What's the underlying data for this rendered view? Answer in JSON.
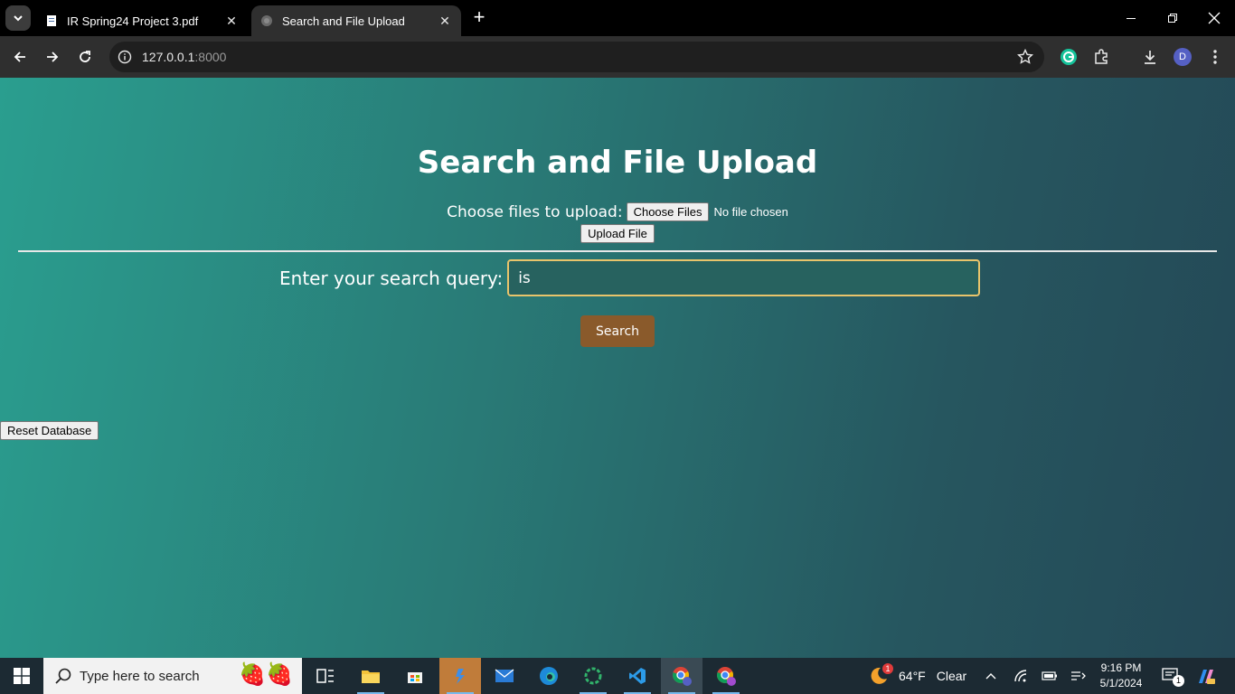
{
  "browser": {
    "tabs": [
      {
        "title": "IR Spring24 Project 3.pdf",
        "active": false
      },
      {
        "title": "Search and File Upload",
        "active": true
      }
    ],
    "url_host": "127.0.0.1",
    "url_port": ":8000",
    "profile_initial": "D"
  },
  "page": {
    "title": "Search and File Upload",
    "upload_label": "Choose files to upload:",
    "choose_files_label": "Choose Files",
    "no_file_text": "No file chosen",
    "upload_button_label": "Upload File",
    "search_label": "Enter your search query:",
    "search_value": "is",
    "search_button_label": "Search",
    "reset_button_label": "Reset Database"
  },
  "taskbar": {
    "search_placeholder": "Type here to search",
    "weather_temp": "64°F",
    "weather_condition": "Clear",
    "weather_badge": "1",
    "time": "9:16 PM",
    "date": "5/1/2024",
    "notification_count": "1"
  },
  "colors": {
    "gradient_start": "#2a9e8f",
    "gradient_end": "#244856",
    "search_button": "#8a5a2b",
    "input_border": "#e8c46b"
  }
}
